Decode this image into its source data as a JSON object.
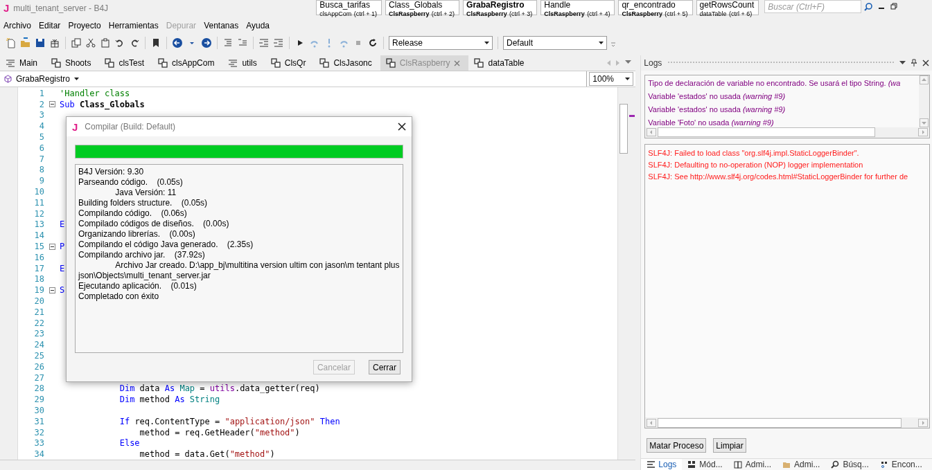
{
  "window": {
    "logo": "J",
    "title": "multi_tenant_server - B4J"
  },
  "doc_tabs": [
    {
      "title": "Busca_tarifas",
      "module": "clsAppCom",
      "current_module": false,
      "shortcut": "(ctrl + 1)",
      "selected": false
    },
    {
      "title": "Class_Globals",
      "module": "ClsRaspberry",
      "current_module": true,
      "shortcut": "(ctrl + 2)",
      "selected": false
    },
    {
      "title": "GrabaRegistro",
      "module": "ClsRaspberry",
      "current_module": true,
      "shortcut": "(ctrl + 3)",
      "selected": true
    },
    {
      "title": "Handle",
      "module": "ClsRaspberry",
      "current_module": true,
      "shortcut": "(ctrl + 4)",
      "selected": false
    },
    {
      "title": "qr_encontrado",
      "module": "ClsRaspberry",
      "current_module": true,
      "shortcut": "(ctrl + 5)",
      "selected": false
    },
    {
      "title": "getRowsCount",
      "module": "dataTable",
      "current_module": false,
      "shortcut": "(ctrl + 6)",
      "selected": false
    }
  ],
  "search": {
    "placeholder": "Buscar (Ctrl+F)"
  },
  "menu": [
    {
      "label": "Archivo",
      "disabled": false
    },
    {
      "label": "Editar",
      "disabled": false
    },
    {
      "label": "Proyecto",
      "disabled": false
    },
    {
      "label": "Herramientas",
      "disabled": false
    },
    {
      "label": "Depurar",
      "disabled": true
    },
    {
      "label": "Ventanas",
      "disabled": false
    },
    {
      "label": "Ayuda",
      "disabled": false
    }
  ],
  "toolbar": {
    "build_mode": "Release",
    "build_config": "Default"
  },
  "editor_tabs": [
    {
      "label": "Main",
      "kind": "code",
      "selected": false
    },
    {
      "label": "Shoots",
      "kind": "class",
      "selected": false
    },
    {
      "label": "clsTest",
      "kind": "class",
      "selected": false
    },
    {
      "label": "clsAppCom",
      "kind": "class",
      "selected": false
    },
    {
      "label": "utils",
      "kind": "code",
      "selected": false
    },
    {
      "label": "ClsQr",
      "kind": "class",
      "selected": false
    },
    {
      "label": "ClsJasonc",
      "kind": "class",
      "selected": false
    },
    {
      "label": "ClsRaspberry",
      "kind": "class",
      "selected": true
    },
    {
      "label": "dataTable",
      "kind": "class",
      "selected": false
    }
  ],
  "sub_selector": "GrabaRegistro",
  "zoom": "100%",
  "code_lines": [
    {
      "number": "1",
      "tokens": [
        {
          "kind": "comment",
          "text": "'Handler class"
        }
      ]
    },
    {
      "number": "2",
      "fold": true,
      "tokens": [
        {
          "kind": "keyword",
          "text": "Sub "
        },
        {
          "kind": "name",
          "text": "Class_Globals"
        }
      ]
    },
    {
      "number": "3"
    },
    {
      "number": "4"
    },
    {
      "number": "5"
    },
    {
      "number": "6"
    },
    {
      "number": "7"
    },
    {
      "number": "8"
    },
    {
      "number": "9"
    },
    {
      "number": "10"
    },
    {
      "number": "11"
    },
    {
      "number": "12"
    },
    {
      "number": "13",
      "tokens": [
        {
          "kind": "keyword",
          "text": "E"
        }
      ]
    },
    {
      "number": "14"
    },
    {
      "number": "15",
      "fold": true,
      "tokens": [
        {
          "kind": "keyword",
          "text": "P"
        }
      ]
    },
    {
      "number": "16"
    },
    {
      "number": "17",
      "tokens": [
        {
          "kind": "keyword",
          "text": "E"
        }
      ]
    },
    {
      "number": "18"
    },
    {
      "number": "19",
      "fold": true,
      "tokens": [
        {
          "kind": "keyword",
          "text": "S"
        }
      ]
    },
    {
      "number": "20"
    },
    {
      "number": "21"
    },
    {
      "number": "22"
    },
    {
      "number": "23"
    },
    {
      "number": "24"
    },
    {
      "number": "25"
    },
    {
      "number": "26"
    },
    {
      "number": "27"
    },
    {
      "number": "28",
      "tokens": [
        {
          "kind": "keyword",
          "text": "            Dim"
        },
        {
          "kind": "plain",
          "text": " data "
        },
        {
          "kind": "keyword",
          "text": "As"
        },
        {
          "kind": "type",
          "text": " Map"
        },
        {
          "kind": "plain",
          "text": " = "
        },
        {
          "kind": "module",
          "text": "utils"
        },
        {
          "kind": "plain",
          "text": ".data_getter(req)"
        }
      ]
    },
    {
      "number": "29",
      "tokens": [
        {
          "kind": "keyword",
          "text": "            Dim"
        },
        {
          "kind": "plain",
          "text": " method "
        },
        {
          "kind": "keyword",
          "text": "As"
        },
        {
          "kind": "type",
          "text": " String"
        }
      ]
    },
    {
      "number": "30"
    },
    {
      "number": "31",
      "tokens": [
        {
          "kind": "keyword",
          "text": "            If"
        },
        {
          "kind": "plain",
          "text": " req.ContentType = "
        },
        {
          "kind": "string",
          "text": "\"application/json\""
        },
        {
          "kind": "keyword",
          "text": " Then"
        }
      ]
    },
    {
      "number": "32",
      "tokens": [
        {
          "kind": "plain",
          "text": "                method = req.GetHeader("
        },
        {
          "kind": "string",
          "text": "\"method\""
        },
        {
          "kind": "plain",
          "text": ")"
        }
      ]
    },
    {
      "number": "33",
      "tokens": [
        {
          "kind": "keyword",
          "text": "            Else"
        }
      ]
    },
    {
      "number": "34",
      "tokens": [
        {
          "kind": "plain",
          "text": "                method = data.Get("
        },
        {
          "kind": "string",
          "text": "\"method\""
        },
        {
          "kind": "plain",
          "text": ")"
        }
      ]
    }
  ],
  "dialog": {
    "logo": "J",
    "title": "Compilar (Build: Default)",
    "progress": {
      "level": 1
    },
    "output": [
      "B4J Versión: 9.30",
      "Parseando código.    (0.05s)",
      "                Java Versión: 11",
      "Building folders structure.    (0.05s)",
      "Compilando código.    (0.06s)",
      "Compilado códigos de diseños.    (0.00s)",
      "Organizando librerías.    (0.00s)",
      "Compilando el código Java generado.    (2.35s)",
      "Compilando archivo jar.    (37.92s)",
      "                Archivo Jar creado. D:\\app_bj\\multitina version ultim con jason\\m tentant plus json\\Objects\\multi_tenant_server.jar",
      "Ejecutando aplicación.    (0.01s)",
      "Completado con éxito"
    ],
    "buttons": [
      {
        "label": "Cancelar",
        "disabled": true
      },
      {
        "label": "Cerrar",
        "disabled": false
      }
    ]
  },
  "logs": {
    "title": "Logs",
    "warnings": [
      {
        "text": "Tipo de declaración de variable no encontrado. Se usará el tipo String. *(wa*"
      },
      {
        "text": "Variable 'estados' no usada *(warning #9)*"
      },
      {
        "text": "Variable 'estados' no usada *(warning #9)*"
      },
      {
        "text": "Variable 'Foto' no usada *(warning #9)*"
      }
    ],
    "output": [
      "SLF4J: Failed to load class \"org.slf4j.impl.StaticLoggerBinder\".",
      "SLF4J: Defaulting to no-operation (NOP) logger implementation",
      "SLF4J: See http://www.slf4j.org/codes.html#StaticLoggerBinder for further de"
    ],
    "buttons": [
      "Matar Proceso",
      "Limpiar"
    ]
  },
  "bottom_tabs": [
    {
      "label": "Logs",
      "kind": "logs",
      "selected": true
    },
    {
      "label": "Mód...",
      "kind": "modules",
      "selected": false
    },
    {
      "label": "Admi...",
      "kind": "libraries",
      "selected": false
    },
    {
      "label": "Admi...",
      "kind": "files",
      "selected": false
    },
    {
      "label": "Búsq...",
      "kind": "search",
      "selected": false
    },
    {
      "label": "Encon...",
      "kind": "find",
      "selected": false
    }
  ]
}
